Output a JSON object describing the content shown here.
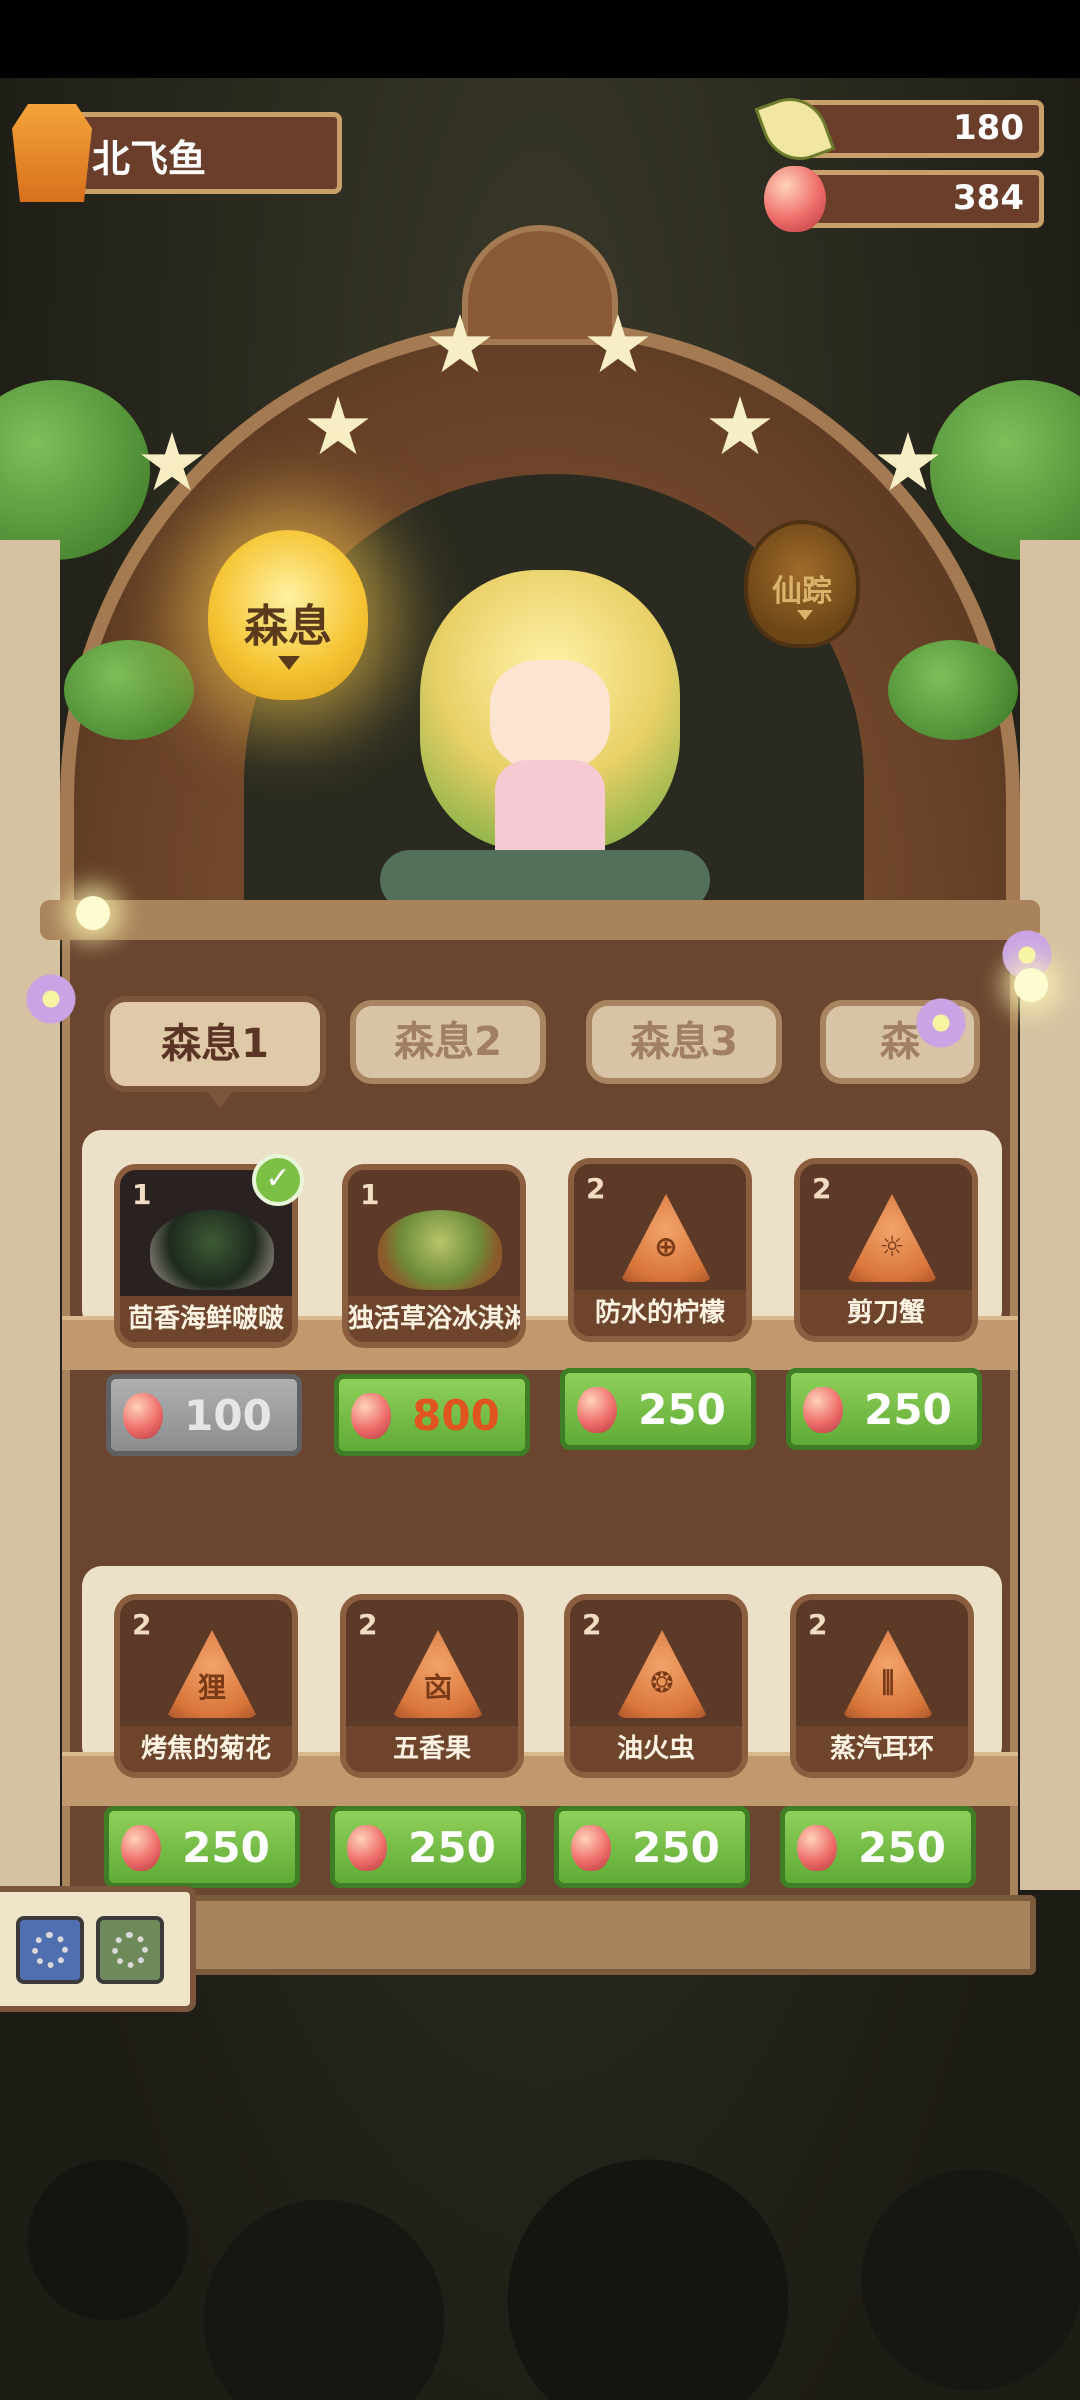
{
  "player": {
    "name": "北飞鱼",
    "avatar_icon": "player-avatar-icon"
  },
  "currency": {
    "leaves": {
      "value": "180",
      "icon": "leaf-icon"
    },
    "beans": {
      "value": "384",
      "icon": "bean-icon"
    }
  },
  "lanterns": {
    "active": "森息",
    "inactive": "仙踪"
  },
  "tabs": [
    "森息1",
    "森息2",
    "森息3",
    "森"
  ],
  "active_tab": 0,
  "shelf_rows": [
    {
      "items": [
        {
          "level": "1",
          "name": "茴香海鲜啵啵",
          "type": "dish-dark",
          "owned": true
        },
        {
          "level": "1",
          "name": "独活草浴冰淇淋",
          "type": "dish",
          "owned": false
        },
        {
          "level": "2",
          "name": "防水的柠檬",
          "type": "rune",
          "glyph": "⊕",
          "owned": false
        },
        {
          "level": "2",
          "name": "剪刀蟹",
          "type": "rune",
          "glyph": "☼",
          "owned": false
        }
      ],
      "prices": [
        {
          "amount": "100",
          "state": "disabled"
        },
        {
          "amount": "800",
          "state": "insufficient"
        },
        {
          "amount": "250",
          "state": "available"
        },
        {
          "amount": "250",
          "state": "available"
        }
      ]
    },
    {
      "items": [
        {
          "level": "2",
          "name": "烤焦的菊花",
          "type": "rune",
          "glyph": "狸",
          "owned": false
        },
        {
          "level": "2",
          "name": "五香果",
          "type": "rune",
          "glyph": "㐫",
          "owned": false
        },
        {
          "level": "2",
          "name": "油火虫",
          "type": "rune",
          "glyph": "❂",
          "owned": false
        },
        {
          "level": "2",
          "name": "蒸汽耳环",
          "type": "rune",
          "glyph": "⫼",
          "owned": false
        }
      ],
      "prices": [
        {
          "amount": "250",
          "state": "available"
        },
        {
          "amount": "250",
          "state": "available"
        },
        {
          "amount": "250",
          "state": "available"
        },
        {
          "amount": "250",
          "state": "available"
        }
      ]
    }
  ],
  "colors": {
    "price_green": "#6fba42",
    "price_disabled": "#9a9c9e",
    "insufficient_text": "#e0541f",
    "wood": "#6a4530"
  }
}
